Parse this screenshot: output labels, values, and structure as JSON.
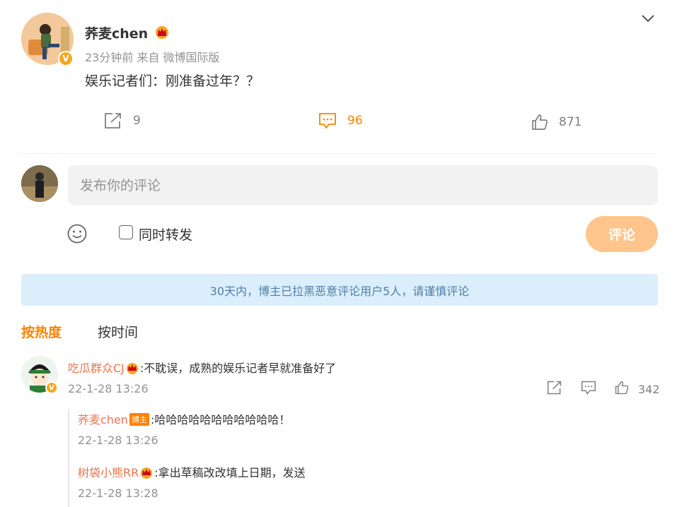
{
  "post": {
    "author": "荞麦chen",
    "time": "23分钟前",
    "source": "来自 微博国际版",
    "text": "娱乐记者们：刚准备过年？？",
    "reposts": "9",
    "comments": "96",
    "likes": "871",
    "verified_badge": "V"
  },
  "composer": {
    "placeholder": "发布你的评论",
    "repost_label": "同时转发",
    "submit_label": "评论"
  },
  "notice": "30天内，博主已拉黑恶意评论用户5人，请谨慎评论",
  "tabs": {
    "hot": "按热度",
    "time": "按时间"
  },
  "comments": [
    {
      "user": "吃瓜群众CJ",
      "text": ":不耽误，成熟的娱乐记者早就准备好了",
      "time": "22-1-28 13:26",
      "likes": "342",
      "replies": [
        {
          "user": "荞麦chen",
          "tag": "博主",
          "text": ":哈哈哈哈哈哈哈哈哈哈哈！",
          "time": "22-1-28 13:26"
        },
        {
          "user": "树袋小熊RR",
          "text": ":拿出草稿改改填上日期，发送",
          "time": "22-1-28 13:28"
        }
      ]
    }
  ],
  "colors": {
    "accent": "#ff8200",
    "username": "#eb7350",
    "notice_bg": "#dbeefc",
    "notice_text": "#4f7fa6",
    "submit_bg": "#ffc58c"
  },
  "icons": {
    "menu": "chevron-down-icon",
    "repost": "repost-icon",
    "comment": "comment-icon",
    "like": "thumbs-up-icon",
    "emoji": "smiley-icon",
    "crown": "crown-badge-icon"
  }
}
